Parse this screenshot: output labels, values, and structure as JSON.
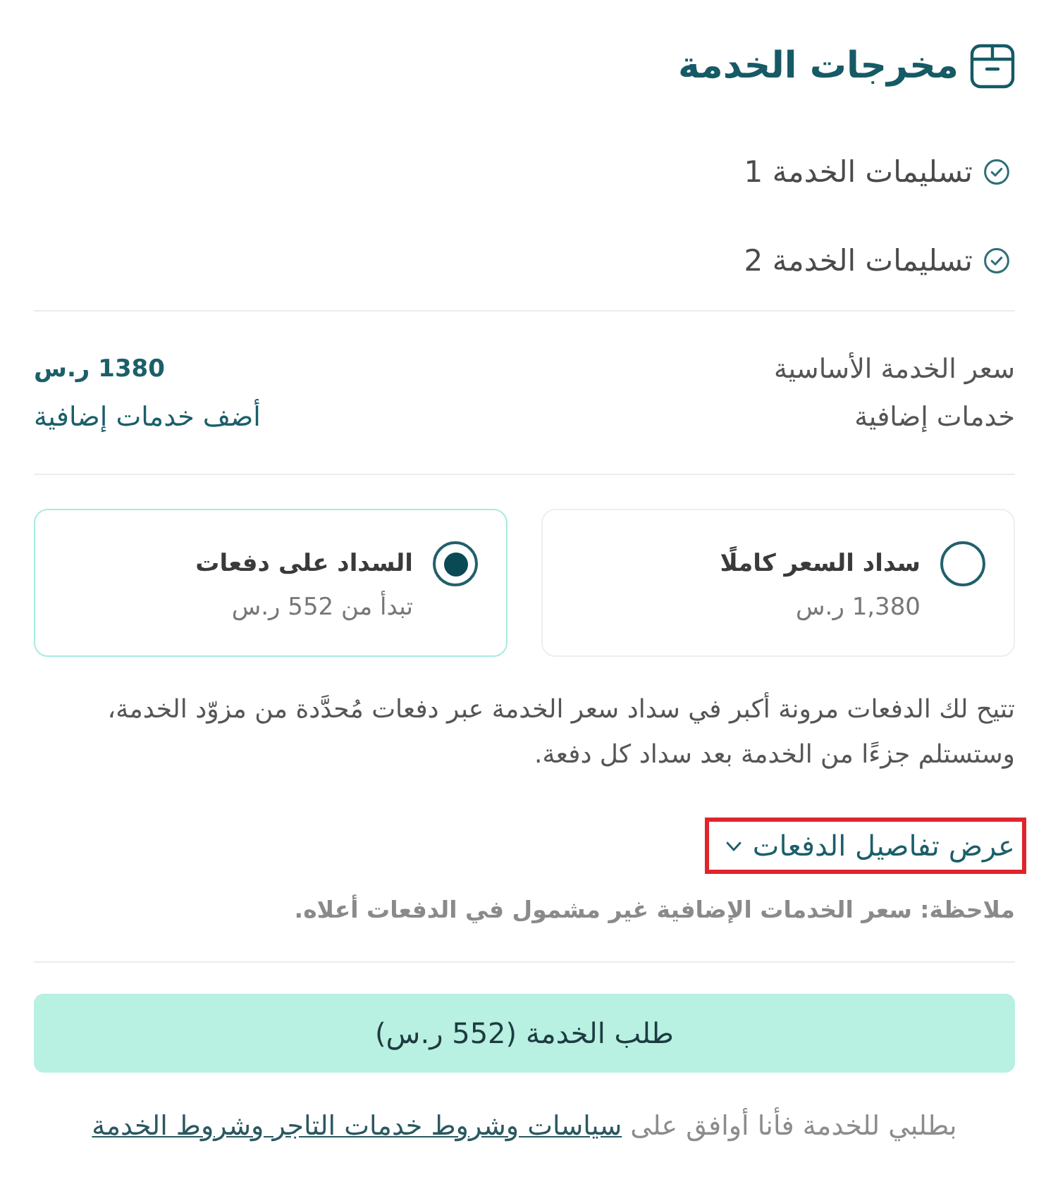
{
  "deliverables": {
    "title": "مخرجات الخدمة",
    "items": [
      {
        "label": "تسليمات الخدمة 1"
      },
      {
        "label": "تسليمات الخدمة 2"
      }
    ]
  },
  "pricing": {
    "rows": [
      {
        "kind": "amount",
        "label": "سعر الخدمة الأساسية",
        "value": "1380 ر.س"
      },
      {
        "kind": "link",
        "label": "خدمات إضافية",
        "value": "أضف خدمات إضافية"
      }
    ]
  },
  "payment_options": [
    {
      "title": "سداد السعر كاملًا",
      "subtitle": "1,380 ر.س",
      "selected": false
    },
    {
      "title": "السداد على دفعات",
      "subtitle": "تبدأ من 552 ر.س",
      "selected": true
    }
  ],
  "description": "تتيح لك الدفعات مرونة أكبر في سداد سعر الخدمة عبر دفعات مُحدَّدة من مزوّد الخدمة، وستستلم جزءًا من الخدمة بعد سداد كل دفعة.",
  "details_toggle": {
    "label": "عرض تفاصيل الدفعات",
    "expanded": false,
    "highlighted": true
  },
  "note": "ملاحظة: سعر الخدمات الإضافية غير مشمول في الدفعات أعلاه.",
  "submit_button": {
    "label": "طلب الخدمة (552 ر.س)"
  },
  "terms": {
    "text": "بطلبي للخدمة فأنا أوافق على",
    "link": "سياسات وشروط خدمات التاجر وشروط الخدمة"
  }
}
